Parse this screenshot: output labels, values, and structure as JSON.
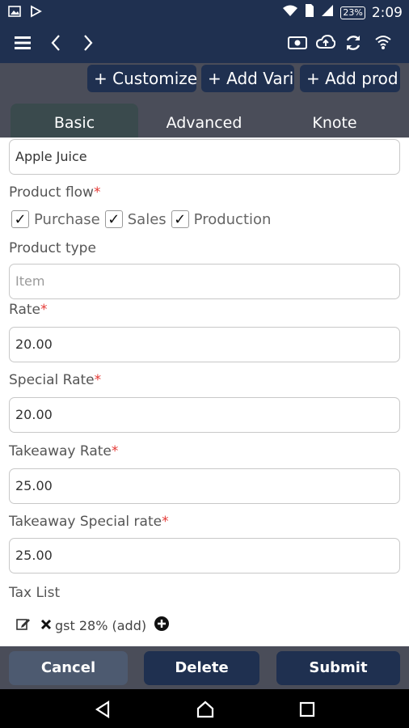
{
  "status_bar": {
    "battery": "23%",
    "time": "2:09"
  },
  "actions": {
    "customize": "+ Customize",
    "add_variant": "+ Add Vari",
    "add_product": "+ Add prod"
  },
  "tabs": [
    "Basic",
    "Advanced",
    "Knote"
  ],
  "form": {
    "name_value": "Apple Juice",
    "product_flow_label": "Product flow",
    "flow_options": [
      "Purchase",
      "Sales",
      "Production"
    ],
    "product_type_label": "Product type",
    "product_type_placeholder": "Item",
    "rate_label": "Rate",
    "rate_value": "20.00",
    "special_rate_label": "Special Rate",
    "special_rate_value": "20.00",
    "takeaway_rate_label": "Takeaway Rate",
    "takeaway_rate_value": "25.00",
    "takeaway_special_label": "Takeaway Special rate",
    "takeaway_special_value": "25.00",
    "tax_list_label": "Tax List",
    "tax_item": "gst 28% (add)",
    "required_mark": "*"
  },
  "buttons": {
    "cancel": "Cancel",
    "delete": "Delete",
    "submit": "Submit"
  },
  "colors": {
    "primary": "#1f3050",
    "bar": "#4a4d59",
    "required": "#e53935"
  }
}
